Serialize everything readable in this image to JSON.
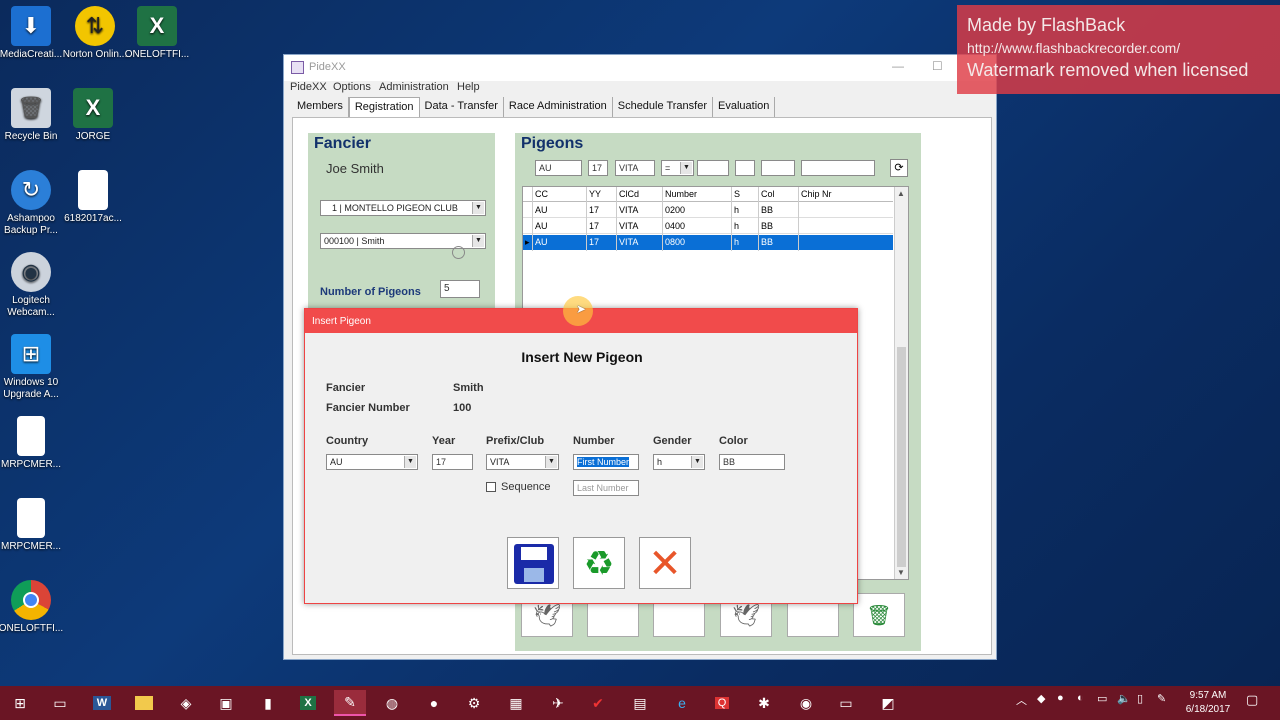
{
  "desktop": {
    "icons": [
      {
        "label": "MediaCreati...",
        "icon": "media-creation-icon"
      },
      {
        "label": "Norton Onlin...",
        "icon": "norton-icon"
      },
      {
        "label": "ONELOFTFI...",
        "icon": "excel-icon"
      },
      {
        "label": "Recycle Bin",
        "icon": "recycle-bin-icon"
      },
      {
        "label": "JORGE",
        "icon": "excel-icon"
      },
      {
        "label": "Ashampoo Backup Pr...",
        "icon": "ashampoo-icon"
      },
      {
        "label": "6182017ac...",
        "icon": "file-icon"
      },
      {
        "label": "Logitech Webcam...",
        "icon": "webcam-icon"
      },
      {
        "label": "Windows 10 Upgrade A...",
        "icon": "windows-icon"
      },
      {
        "label": "MRPCMER...",
        "icon": "file-icon"
      },
      {
        "label": "MRPCMER...",
        "icon": "file-icon"
      },
      {
        "label": "ONELOFTFI...",
        "icon": "chrome-icon"
      }
    ]
  },
  "watermark": {
    "line1": "Made by FlashBack",
    "line2": "http://www.flashbackrecorder.com/",
    "line3": "Watermark removed when licensed"
  },
  "window": {
    "title": "PideXX",
    "menu": [
      "PideXX",
      "Options",
      "Administration",
      "Help"
    ],
    "tabs": [
      "Members",
      "Registration",
      "Data - Transfer",
      "Race Administration",
      "Schedule Transfer",
      "Evaluation"
    ],
    "active_tab": "Registration"
  },
  "fancier_panel": {
    "title": "Fancier",
    "name": "Joe Smith",
    "club_select": "1 | MONTELLO PIGEON CLUB",
    "member_select": "000100 | Smith",
    "num_pigeons_label": "Number of Pigeons",
    "num_pigeons_value": "5"
  },
  "pigeons_panel": {
    "title": "Pigeons",
    "filters": {
      "cc": "AU",
      "yy": "17",
      "club": "VITA",
      "op": "="
    },
    "columns": [
      "CC",
      "YY",
      "ClCd",
      "Number",
      "S",
      "Col",
      "Chip Nr"
    ],
    "rows": [
      [
        "AU",
        "17",
        "VITA",
        "0200",
        "h",
        "BB",
        ""
      ],
      [
        "AU",
        "17",
        "VITA",
        "0400",
        "h",
        "BB",
        ""
      ],
      [
        "AU",
        "17",
        "VITA",
        "0800",
        "h",
        "BB",
        ""
      ]
    ],
    "selected_row": 2
  },
  "dialog": {
    "title": "Insert Pigeon",
    "heading": "Insert New Pigeon",
    "fancier_label": "Fancier",
    "fancier_value": "Smith",
    "fancier_number_label": "Fancier Number",
    "fancier_number_value": "100",
    "country_label": "Country",
    "country_value": "AU",
    "year_label": "Year",
    "year_value": "17",
    "prefix_label": "Prefix/Club",
    "prefix_value": "VITA",
    "number_label": "Number",
    "first_number_placeholder": "First Number",
    "last_number_placeholder": "Last Number",
    "gender_label": "Gender",
    "gender_value": "h",
    "color_label": "Color",
    "color_value": "BB",
    "sequence_label": "Sequence"
  },
  "taskbar": {
    "time": "9:57 AM",
    "date": "6/18/2017"
  }
}
